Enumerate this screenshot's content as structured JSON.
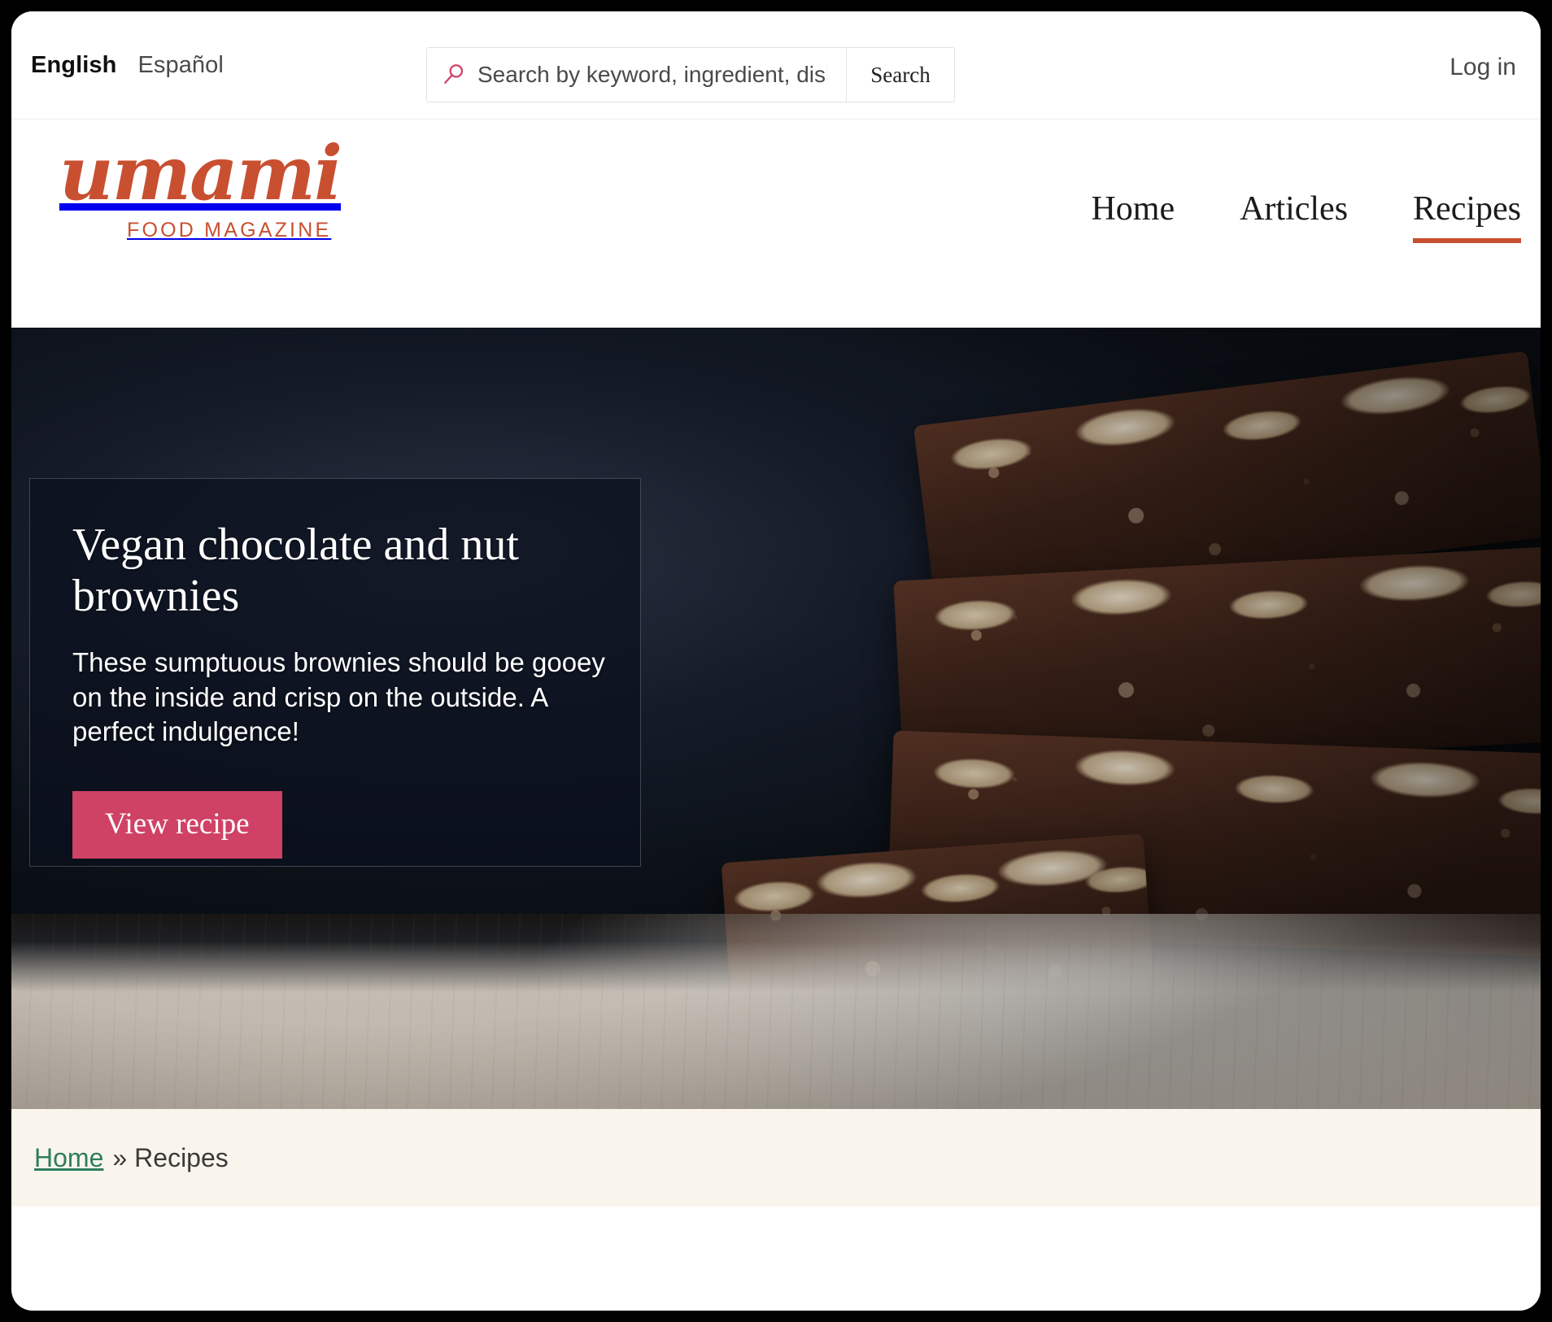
{
  "utility": {
    "languages": [
      {
        "label": "English",
        "active": true
      },
      {
        "label": "Español",
        "active": false
      }
    ],
    "search": {
      "placeholder": "Search by keyword, ingredient, dish",
      "value": "",
      "button_label": "Search",
      "icon": "search-icon",
      "icon_color": "#cf4265"
    },
    "login_label": "Log in"
  },
  "brand": {
    "name": "umami",
    "tagline": "FOOD MAGAZINE",
    "color": "#c94f31"
  },
  "nav": {
    "items": [
      {
        "label": "Home",
        "active": false
      },
      {
        "label": "Articles",
        "active": false
      },
      {
        "label": "Recipes",
        "active": true
      }
    ],
    "active_underline_color": "#c94f31"
  },
  "hero": {
    "image_alt": "Stack of vegan chocolate and nut brownies on a wooden table",
    "title": "Vegan chocolate and nut brownies",
    "description": "These sumptuous brownies should be gooey on the inside and crisp on the outside. A perfect indulgence!",
    "cta_label": "View recipe",
    "cta_color": "#cf4265"
  },
  "breadcrumb": {
    "home_label": "Home",
    "separator": "»",
    "current_label": "Recipes",
    "link_color": "#2e7d5f",
    "background": "#faf5ec"
  }
}
